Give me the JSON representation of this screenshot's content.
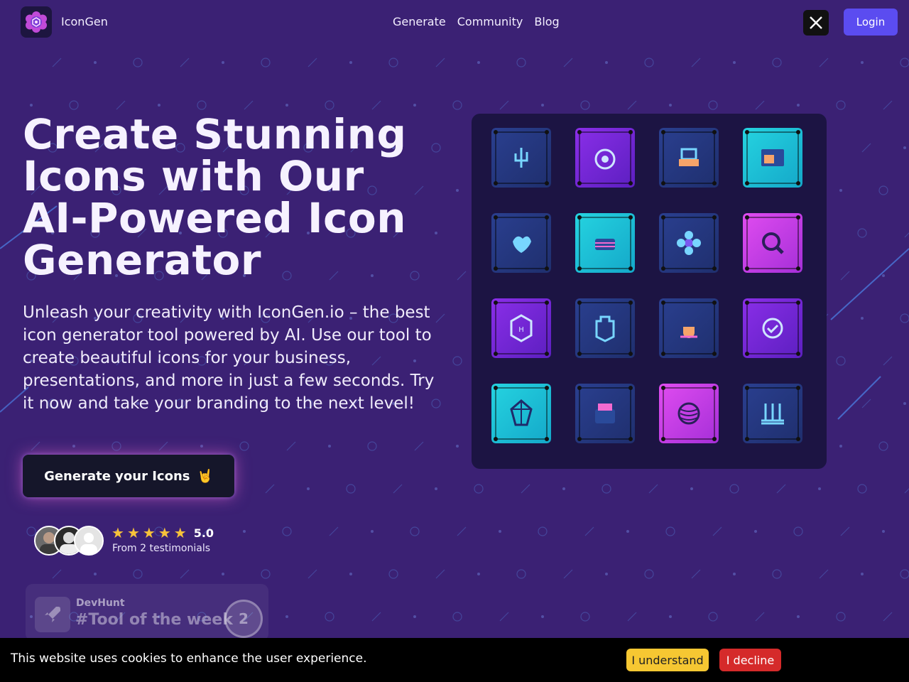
{
  "nav": {
    "brand": "IconGen",
    "links": [
      "Generate",
      "Community",
      "Blog"
    ],
    "login_label": "Login",
    "social_icon": "x-icon"
  },
  "hero": {
    "title_lines": [
      "Create Stunning",
      "Icons with Our",
      "AI-Powered Icon",
      "Generator"
    ],
    "description": "Unleash your creativity with IconGen.io – the best icon generator tool powered by AI. Use our tool to create beautiful icons for your business, presentations, and more in just a few seconds. Try it now and take your branding to the next level!",
    "cta_label": "Generate your Icons",
    "cta_emoji": "🤘"
  },
  "rating": {
    "stars": 5,
    "score": "5.0",
    "testimonials": "From 2 testimonials"
  },
  "devhunt": {
    "name": "DevHunt",
    "tag": "#Tool of the week",
    "rank": "2"
  },
  "icon_grid": {
    "tiles": [
      {
        "name": "cactus-icon",
        "style": "navy"
      },
      {
        "name": "robot-icon",
        "style": "purple"
      },
      {
        "name": "printer-icon",
        "style": "navy"
      },
      {
        "name": "browser-window-icon",
        "style": "cyan"
      },
      {
        "name": "heart-hand-icon",
        "style": "navy"
      },
      {
        "name": "cake-icon",
        "style": "cyan"
      },
      {
        "name": "flower-icon",
        "style": "navy"
      },
      {
        "name": "magnifier-icon",
        "style": "magenta"
      },
      {
        "name": "shield-badge-icon",
        "style": "purple"
      },
      {
        "name": "ship-icon",
        "style": "navy"
      },
      {
        "name": "coffee-cup-icon",
        "style": "navy"
      },
      {
        "name": "target-check-icon",
        "style": "purple"
      },
      {
        "name": "crystal-gem-icon",
        "style": "cyan"
      },
      {
        "name": "toaster-icon",
        "style": "navy"
      },
      {
        "name": "yarn-ball-icon",
        "style": "magenta"
      },
      {
        "name": "columns-chart-icon",
        "style": "navy"
      }
    ]
  },
  "cookie": {
    "message": "This website uses cookies to enhance the user experience.",
    "accept_label": "I understand",
    "decline_label": "I decline"
  },
  "colors": {
    "background": "#3b2174",
    "accent": "#5b4cf0",
    "cta_bg": "#15162a",
    "star": "#f7c23a",
    "accept": "#f6c732",
    "decline": "#d52a2a"
  }
}
